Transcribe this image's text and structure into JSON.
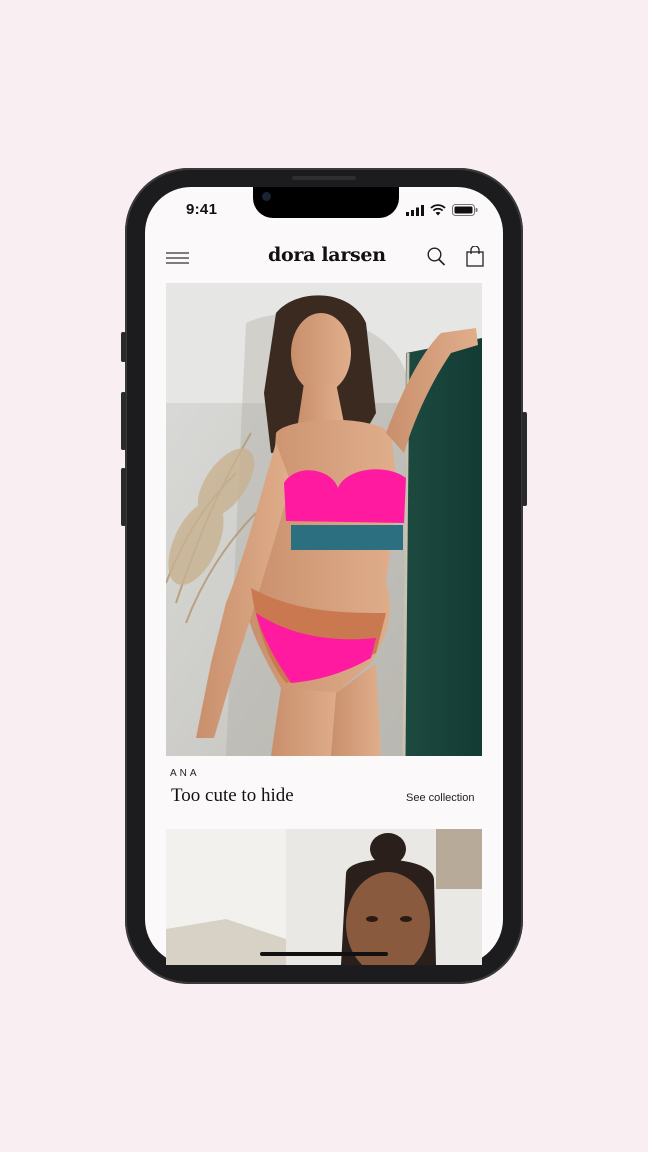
{
  "status_bar": {
    "time": "9:41"
  },
  "header": {
    "brand": "dora larsen",
    "menu_icon": "hamburger-menu-icon",
    "search_icon": "search-icon",
    "bag_icon": "shopping-bag-icon"
  },
  "collections": [
    {
      "eyebrow": "ANA",
      "title": "Too cute to hide",
      "link": "See collection"
    }
  ],
  "colors": {
    "background": "#f9eef2",
    "screen": "#fbf9f9",
    "accent_pink": "#ff1aa0",
    "teal_band": "#2c6f80"
  }
}
